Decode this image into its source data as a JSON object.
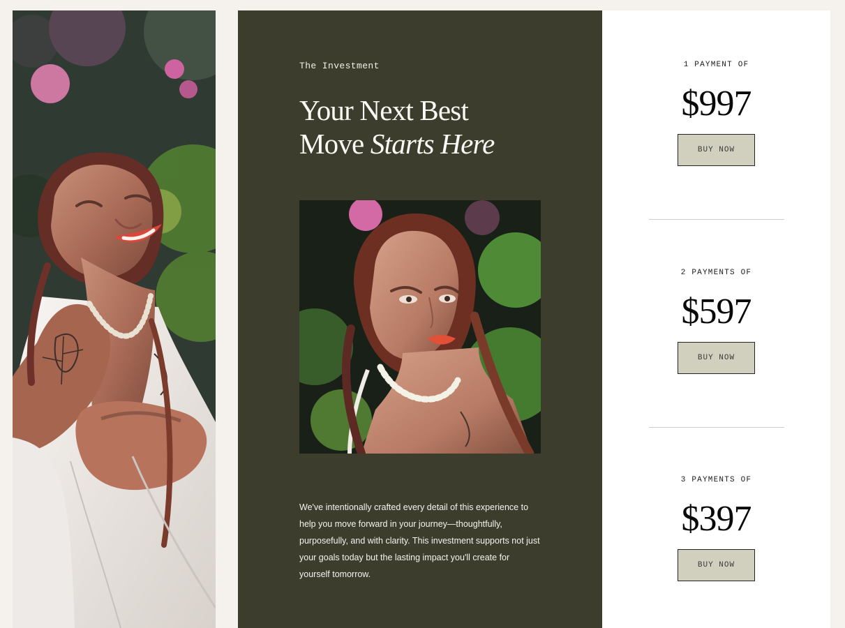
{
  "investment": {
    "eyebrow": "The Investment",
    "headline_line_1": "Your Next Best",
    "headline_line_2_plain": "Move",
    "headline_line_2_italic": "Starts Here",
    "description": "We've intentionally crafted every detail of this experience to help you move forward in your journey—thoughtfully, purposefully, and with clarity. This investment supports not just your goals today but the lasting impact you'll create for yourself tomorrow."
  },
  "pricing": [
    {
      "label": "1 PAYMENT OF",
      "amount": "$997",
      "button": "BUY NOW"
    },
    {
      "label": "2 PAYMENTS OF",
      "amount": "$597",
      "button": "BUY NOW"
    },
    {
      "label": "3 PAYMENTS OF",
      "amount": "$397",
      "button": "BUY NOW"
    }
  ],
  "colors": {
    "page_background": "#f5f2ed",
    "dark_panel": "#3c3d2d",
    "pricing_background": "#ffffff",
    "button_background": "#d1d0bf",
    "button_border": "#232323",
    "divider": "#cfcfca"
  }
}
